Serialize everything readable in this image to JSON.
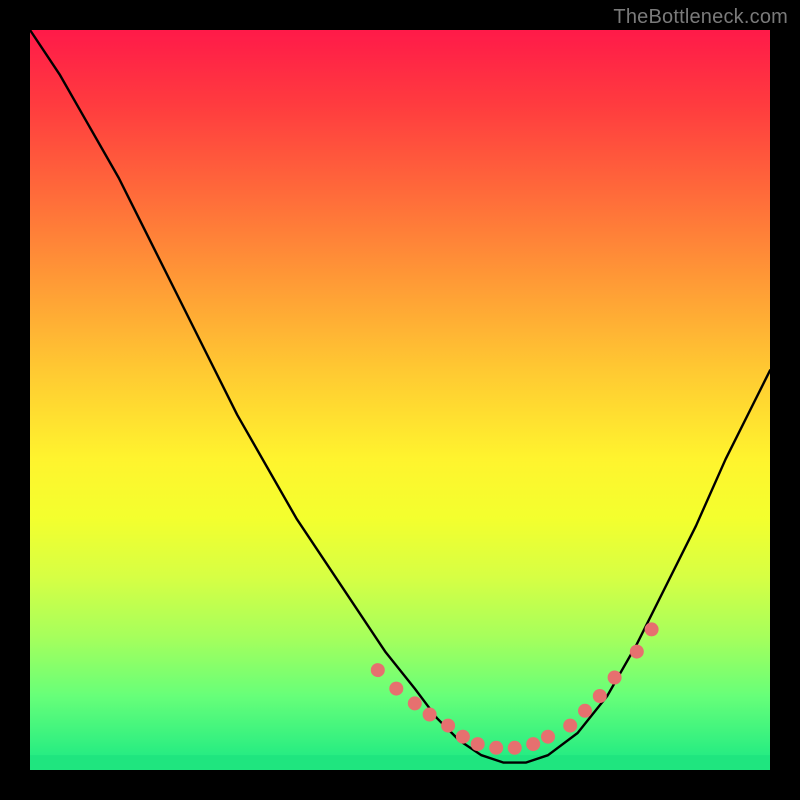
{
  "watermark": "TheBottleneck.com",
  "chart_data": {
    "type": "line",
    "title": "",
    "xlabel": "",
    "ylabel": "",
    "xlim": [
      0,
      100
    ],
    "ylim": [
      0,
      100
    ],
    "grid": false,
    "legend": false,
    "series": [
      {
        "name": "curve",
        "x": [
          0,
          4,
          8,
          12,
          16,
          20,
          24,
          28,
          32,
          36,
          40,
          44,
          48,
          52,
          55,
          58,
          61,
          64,
          67,
          70,
          74,
          78,
          82,
          86,
          90,
          94,
          98,
          100
        ],
        "y": [
          100,
          94,
          87,
          80,
          72,
          64,
          56,
          48,
          41,
          34,
          28,
          22,
          16,
          11,
          7,
          4,
          2,
          1,
          1,
          2,
          5,
          10,
          17,
          25,
          33,
          42,
          50,
          54
        ]
      }
    ],
    "markers": {
      "name": "dots",
      "color": "#e6706f",
      "radius_px": 7,
      "x": [
        47,
        49.5,
        52,
        54,
        56.5,
        58.5,
        60.5,
        63,
        65.5,
        68,
        70,
        73,
        75,
        77,
        79,
        82,
        84
      ],
      "y": [
        13.5,
        11,
        9,
        7.5,
        6,
        4.5,
        3.5,
        3,
        3,
        3.5,
        4.5,
        6,
        8,
        10,
        12.5,
        16,
        19
      ]
    },
    "bottom_bar": {
      "color": "#1fe57f",
      "y0": 0,
      "y1": 2
    }
  }
}
